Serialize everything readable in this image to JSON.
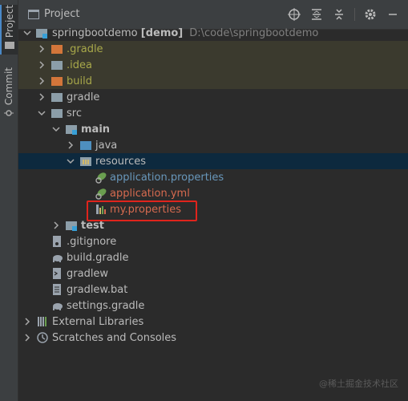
{
  "sidebar": {
    "tabs": [
      {
        "label": "Project",
        "icon": "folder-icon"
      },
      {
        "label": "Commit",
        "icon": "commit-icon"
      }
    ]
  },
  "header": {
    "title": "Project",
    "tools": [
      "locate-icon",
      "expand-all-icon",
      "collapse-all-icon",
      "gear-icon",
      "minimize-icon"
    ]
  },
  "tree": {
    "root": {
      "name": "springbootdemo",
      "module": "[demo]",
      "path": "D:\\code\\springbootdemo"
    },
    "items": [
      {
        "label": ".gradle"
      },
      {
        "label": ".idea"
      },
      {
        "label": "build"
      },
      {
        "label": "gradle"
      },
      {
        "label": "src"
      },
      {
        "label": "main"
      },
      {
        "label": "java"
      },
      {
        "label": "resources"
      },
      {
        "label": "application.properties"
      },
      {
        "label": "application.yml"
      },
      {
        "label": "my.properties"
      },
      {
        "label": "test"
      },
      {
        "label": ".gitignore"
      },
      {
        "label": "build.gradle"
      },
      {
        "label": "gradlew"
      },
      {
        "label": "gradlew.bat"
      },
      {
        "label": "settings.gradle"
      },
      {
        "label": "External Libraries"
      },
      {
        "label": "Scratches and Consoles"
      }
    ]
  },
  "colors": {
    "ignored_text": "#a8a84a",
    "highlight_border": "#e0241c",
    "selection_bg": "#0d293e"
  },
  "watermark": "@稀土掘金技术社区"
}
